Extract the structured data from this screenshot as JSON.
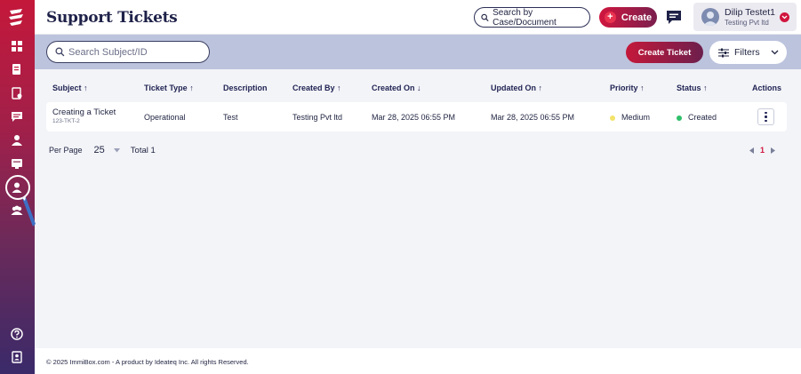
{
  "header": {
    "title": "Support Tickets",
    "search_case_label": "Search by Case/Document",
    "create_label": "Create"
  },
  "user": {
    "name": "Dilip Testet1",
    "org": "Testing Pvt ltd"
  },
  "toolbar": {
    "search_placeholder": "Search Subject/ID",
    "create_ticket_label": "Create Ticket",
    "filters_label": "Filters"
  },
  "table": {
    "columns": [
      "Subject ↑",
      "Ticket Type ↑",
      "Description",
      "Created By ↑",
      "Created On ↓",
      "Updated On ↑",
      "Priority ↑",
      "Status ↑",
      "Actions"
    ],
    "rows": [
      {
        "subject": "Creating a Ticket",
        "id": "123-TKT-2",
        "type": "Operational",
        "description": "Test",
        "created_by": "Testing Pvt ltd",
        "created_on": "Mar 28, 2025 06:55 PM",
        "updated_on": "Mar 28, 2025 06:55 PM",
        "priority": "Medium",
        "status": "Created"
      }
    ]
  },
  "pagination": {
    "per_page_label": "Per Page",
    "per_page_value": "25",
    "total_label": "Total 1",
    "current_page": "1"
  },
  "footer": {
    "text": "© 2025 ImmiBox.com - A product by Ideateq Inc. All rights Reserved."
  },
  "colors": {
    "accent": "#d0163e",
    "navy": "#1e2148",
    "band": "#bcc3dd",
    "priority_medium": "#f3e36a",
    "status_created": "#2fbf6a"
  },
  "icons": [
    "logo",
    "dashboard-icon",
    "documents-icon",
    "forms-icon",
    "chat-icon",
    "users-icon",
    "notes-icon",
    "profile-icon",
    "team-icon",
    "help-icon",
    "contacts-icon"
  ]
}
